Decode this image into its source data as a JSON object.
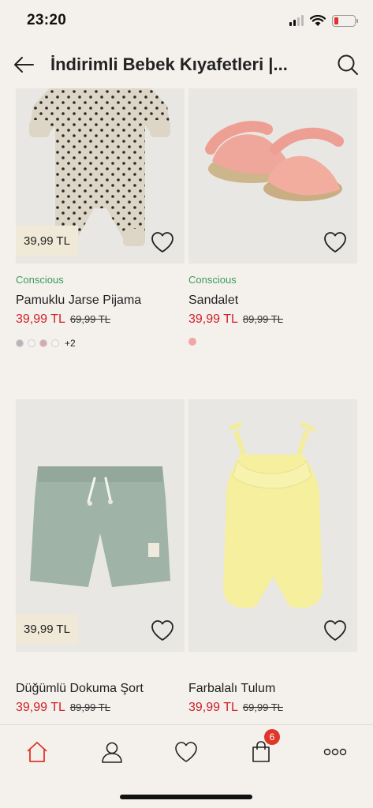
{
  "status_bar": {
    "time": "23:20"
  },
  "header": {
    "title": "İndirimli Bebek Kıyafetleri |...",
    "back_icon": "arrow-left-icon",
    "search_icon": "search-icon"
  },
  "products": [
    {
      "image_price": "39,99 TL",
      "badge": "Conscious",
      "name": "Pamuklu Jarse Pijama",
      "price": "39,99 TL",
      "old_price": "69,99 TL",
      "swatches": [
        "#b5b5b5",
        "#f2f2f2",
        "#d9a9b2",
        "#f4f4f4"
      ],
      "more_colors": "+2"
    },
    {
      "image_price": "",
      "badge": "Conscious",
      "name": "Sandalet",
      "price": "39,99 TL",
      "old_price": "89,99 TL",
      "swatches": [
        "#f0a6a6"
      ],
      "more_colors": ""
    },
    {
      "image_price": "39,99 TL",
      "badge": "",
      "name": "Düğümlü Dokuma Şort",
      "price": "39,99 TL",
      "old_price": "89,99 TL",
      "swatches": [],
      "more_colors": ""
    },
    {
      "image_price": "",
      "badge": "",
      "name": "Farbalalı Tulum",
      "price": "39,99 TL",
      "old_price": "69,99 TL",
      "swatches": [],
      "more_colors": ""
    }
  ],
  "tab_bar": {
    "items": [
      "home-icon",
      "profile-icon",
      "favorites-icon",
      "cart-icon",
      "more-icon"
    ],
    "cart_count": "6"
  },
  "colors": {
    "accent": "#e0352b",
    "badge_green": "#3d9a5c",
    "sale_red": "#d0202a",
    "background": "#f4f1ec"
  }
}
